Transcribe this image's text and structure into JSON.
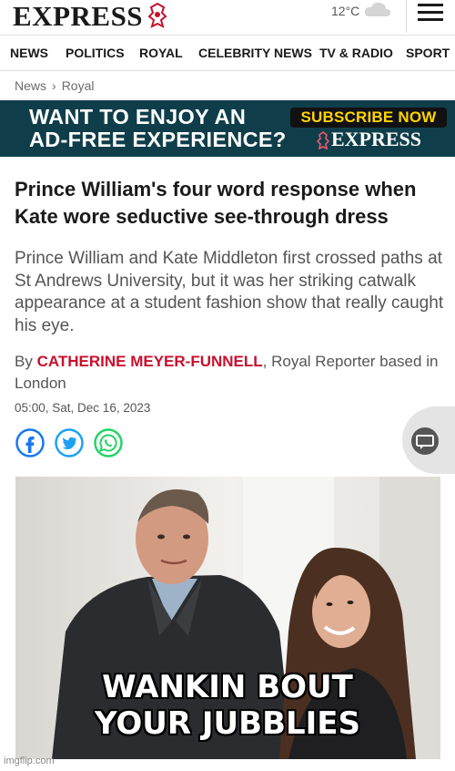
{
  "header": {
    "logo": "EXPRESS",
    "weather": "12°C"
  },
  "nav": {
    "items": [
      "NEWS",
      "POLITICS",
      "ROYAL",
      "CELEBRITY NEWS",
      "TV & RADIO",
      "SPORT"
    ]
  },
  "breadcrumb": {
    "parent": "News",
    "current": "Royal"
  },
  "banner": {
    "line1": "WANT TO ENJOY AN",
    "line2": "AD-FREE EXPERIENCE?",
    "cta": "SUBSCRIBE NOW",
    "logo": "EXPRESS"
  },
  "article": {
    "headline": "Prince William's four word response when Kate wore seductive see-through dress",
    "summary": "Prince William and Kate Middleton first crossed paths at St Andrews University, but it was her striking catwalk appearance at a student fashion show that really caught his eye.",
    "byline_prefix": "By",
    "author": "CATHERINE MEYER-FUNNELL",
    "byline_suffix": ", Royal Reporter based in London",
    "date": "05:00, Sat, Dec 16, 2023"
  },
  "share": {
    "icons": [
      "facebook-icon",
      "twitter-icon",
      "whatsapp-icon",
      "comment-icon"
    ]
  },
  "meme": {
    "caption_line1": "WANKIN BOUT",
    "caption_line2": "YOUR JUBBLIES",
    "watermark": "imgflip.com"
  },
  "colors": {
    "banner_bg": "#0f3e4a",
    "cta_text": "#ffd400",
    "author": "#c8102e",
    "facebook": "#1877f2",
    "twitter": "#1da1f2",
    "whatsapp": "#25d366"
  }
}
